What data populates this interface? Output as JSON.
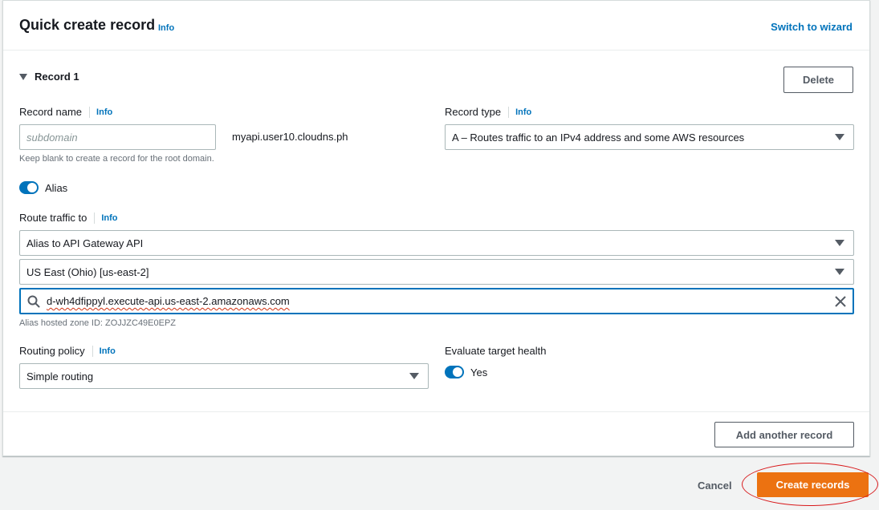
{
  "header": {
    "title": "Quick create record",
    "info": "Info",
    "switch_wizard": "Switch to wizard"
  },
  "record": {
    "title": "Record 1",
    "delete_label": "Delete",
    "record_name": {
      "label": "Record name",
      "info": "Info",
      "placeholder": "subdomain",
      "value": "",
      "suffix": "myapi.user10.cloudns.ph",
      "hint": "Keep blank to create a record for the root domain."
    },
    "record_type": {
      "label": "Record type",
      "info": "Info",
      "value": "A – Routes traffic to an IPv4 address and some AWS resources"
    },
    "alias": {
      "label": "Alias",
      "enabled": true
    },
    "route_traffic": {
      "label": "Route traffic to",
      "info": "Info",
      "endpoint": "Alias to API Gateway API",
      "region": "US East (Ohio) [us-east-2]",
      "search_value": "d-wh4dfippyl.execute-api.us-east-2.amazonaws.com",
      "hosted_zone": "Alias hosted zone ID: ZOJJZC49E0EPZ"
    },
    "routing_policy": {
      "label": "Routing policy",
      "info": "Info",
      "value": "Simple routing"
    },
    "evaluate_health": {
      "label": "Evaluate target health",
      "toggle_label": "Yes",
      "enabled": true
    },
    "add_another_label": "Add another record"
  },
  "footer": {
    "cancel_label": "Cancel",
    "create_label": "Create records"
  },
  "colors": {
    "accent": "#0073bb",
    "primary_button": "#ec7211",
    "annotation": "#d8191b"
  }
}
